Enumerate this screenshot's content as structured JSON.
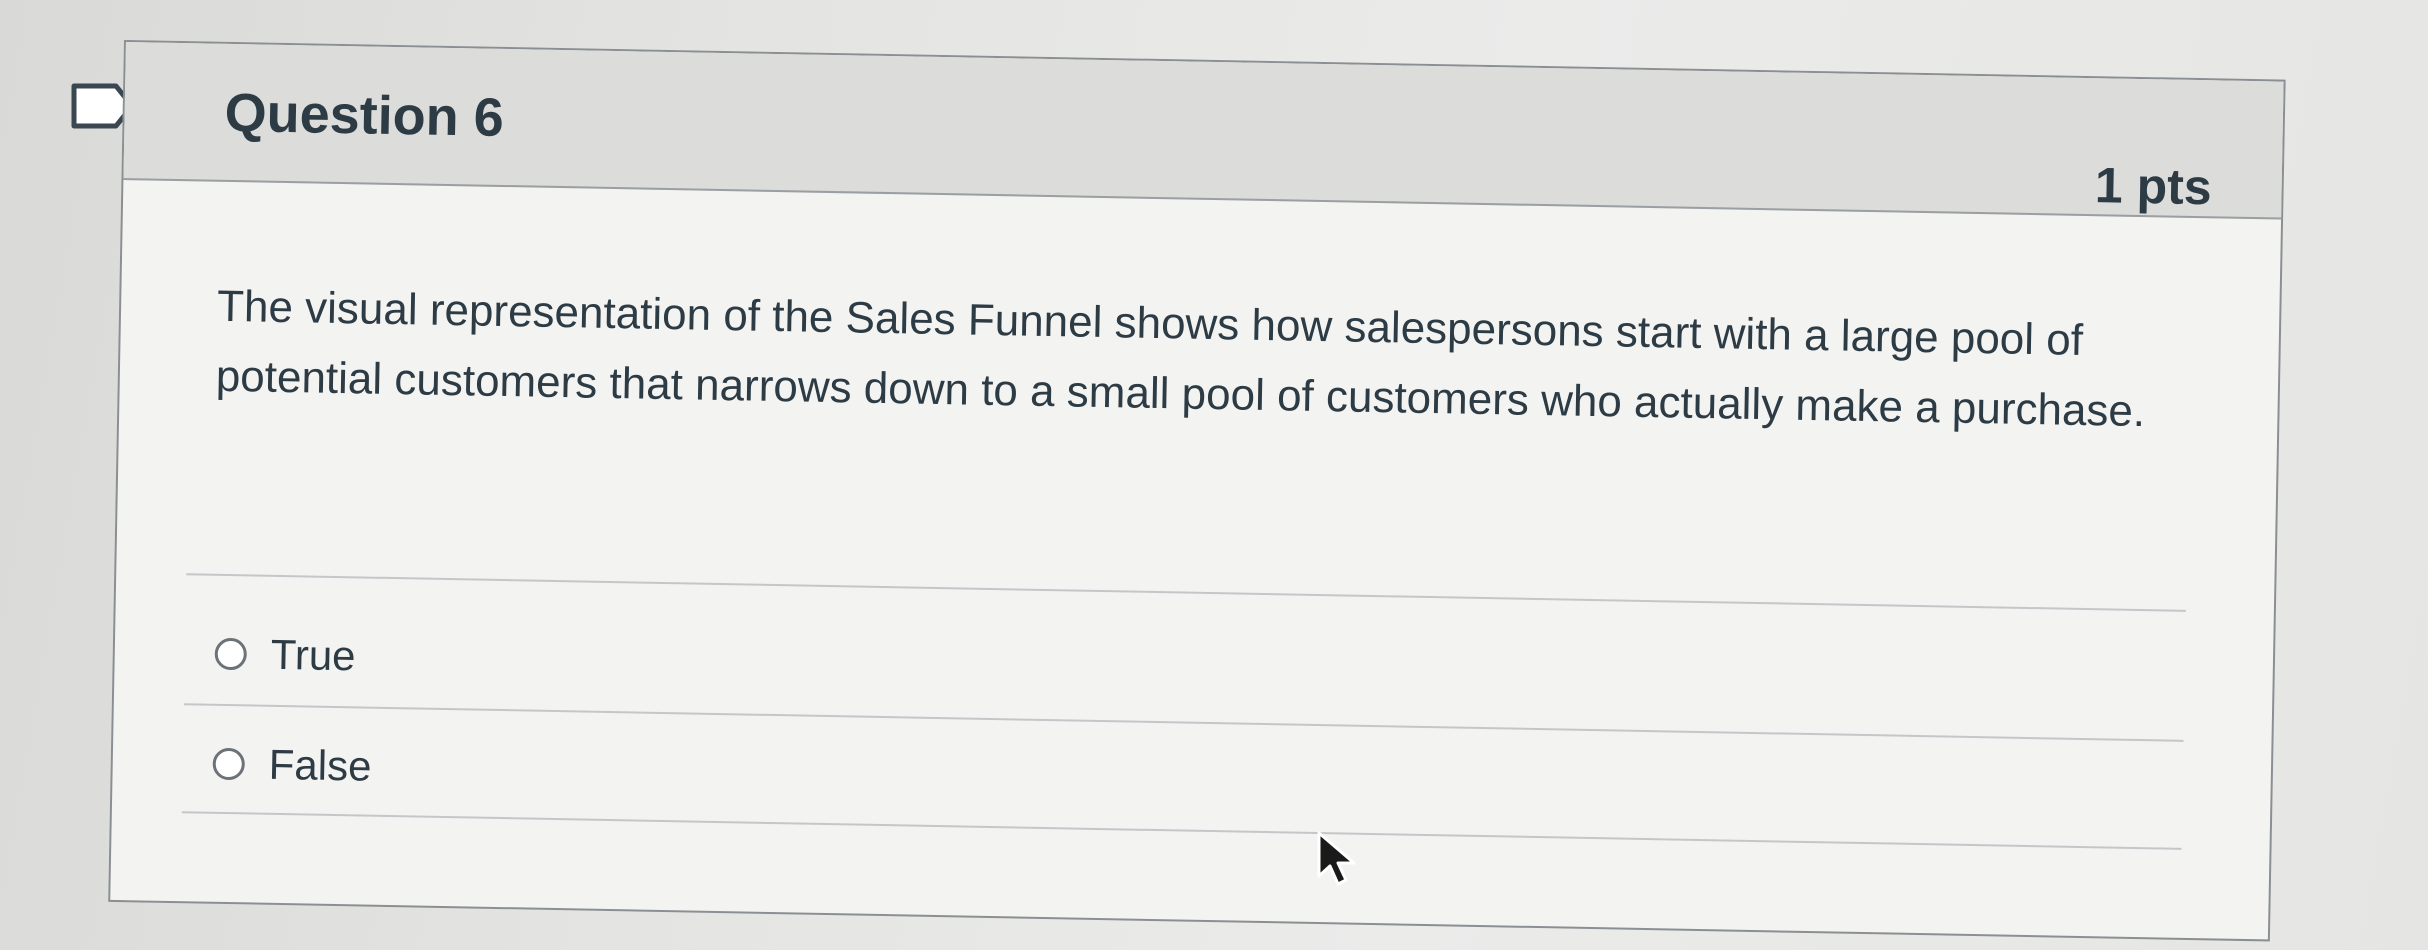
{
  "question": {
    "title": "Question 6",
    "points": "1 pts",
    "text": "The visual representation of the Sales Funnel shows how salespersons start with a large pool of potential customers that narrows down to a small pool of customers who actually make a purchase."
  },
  "answers": [
    {
      "label": "True",
      "selected": false
    },
    {
      "label": "False",
      "selected": false
    }
  ],
  "colors": {
    "header_bg": "#dcdcdb",
    "text": "#2d3b45",
    "border": "#8a8f93"
  }
}
